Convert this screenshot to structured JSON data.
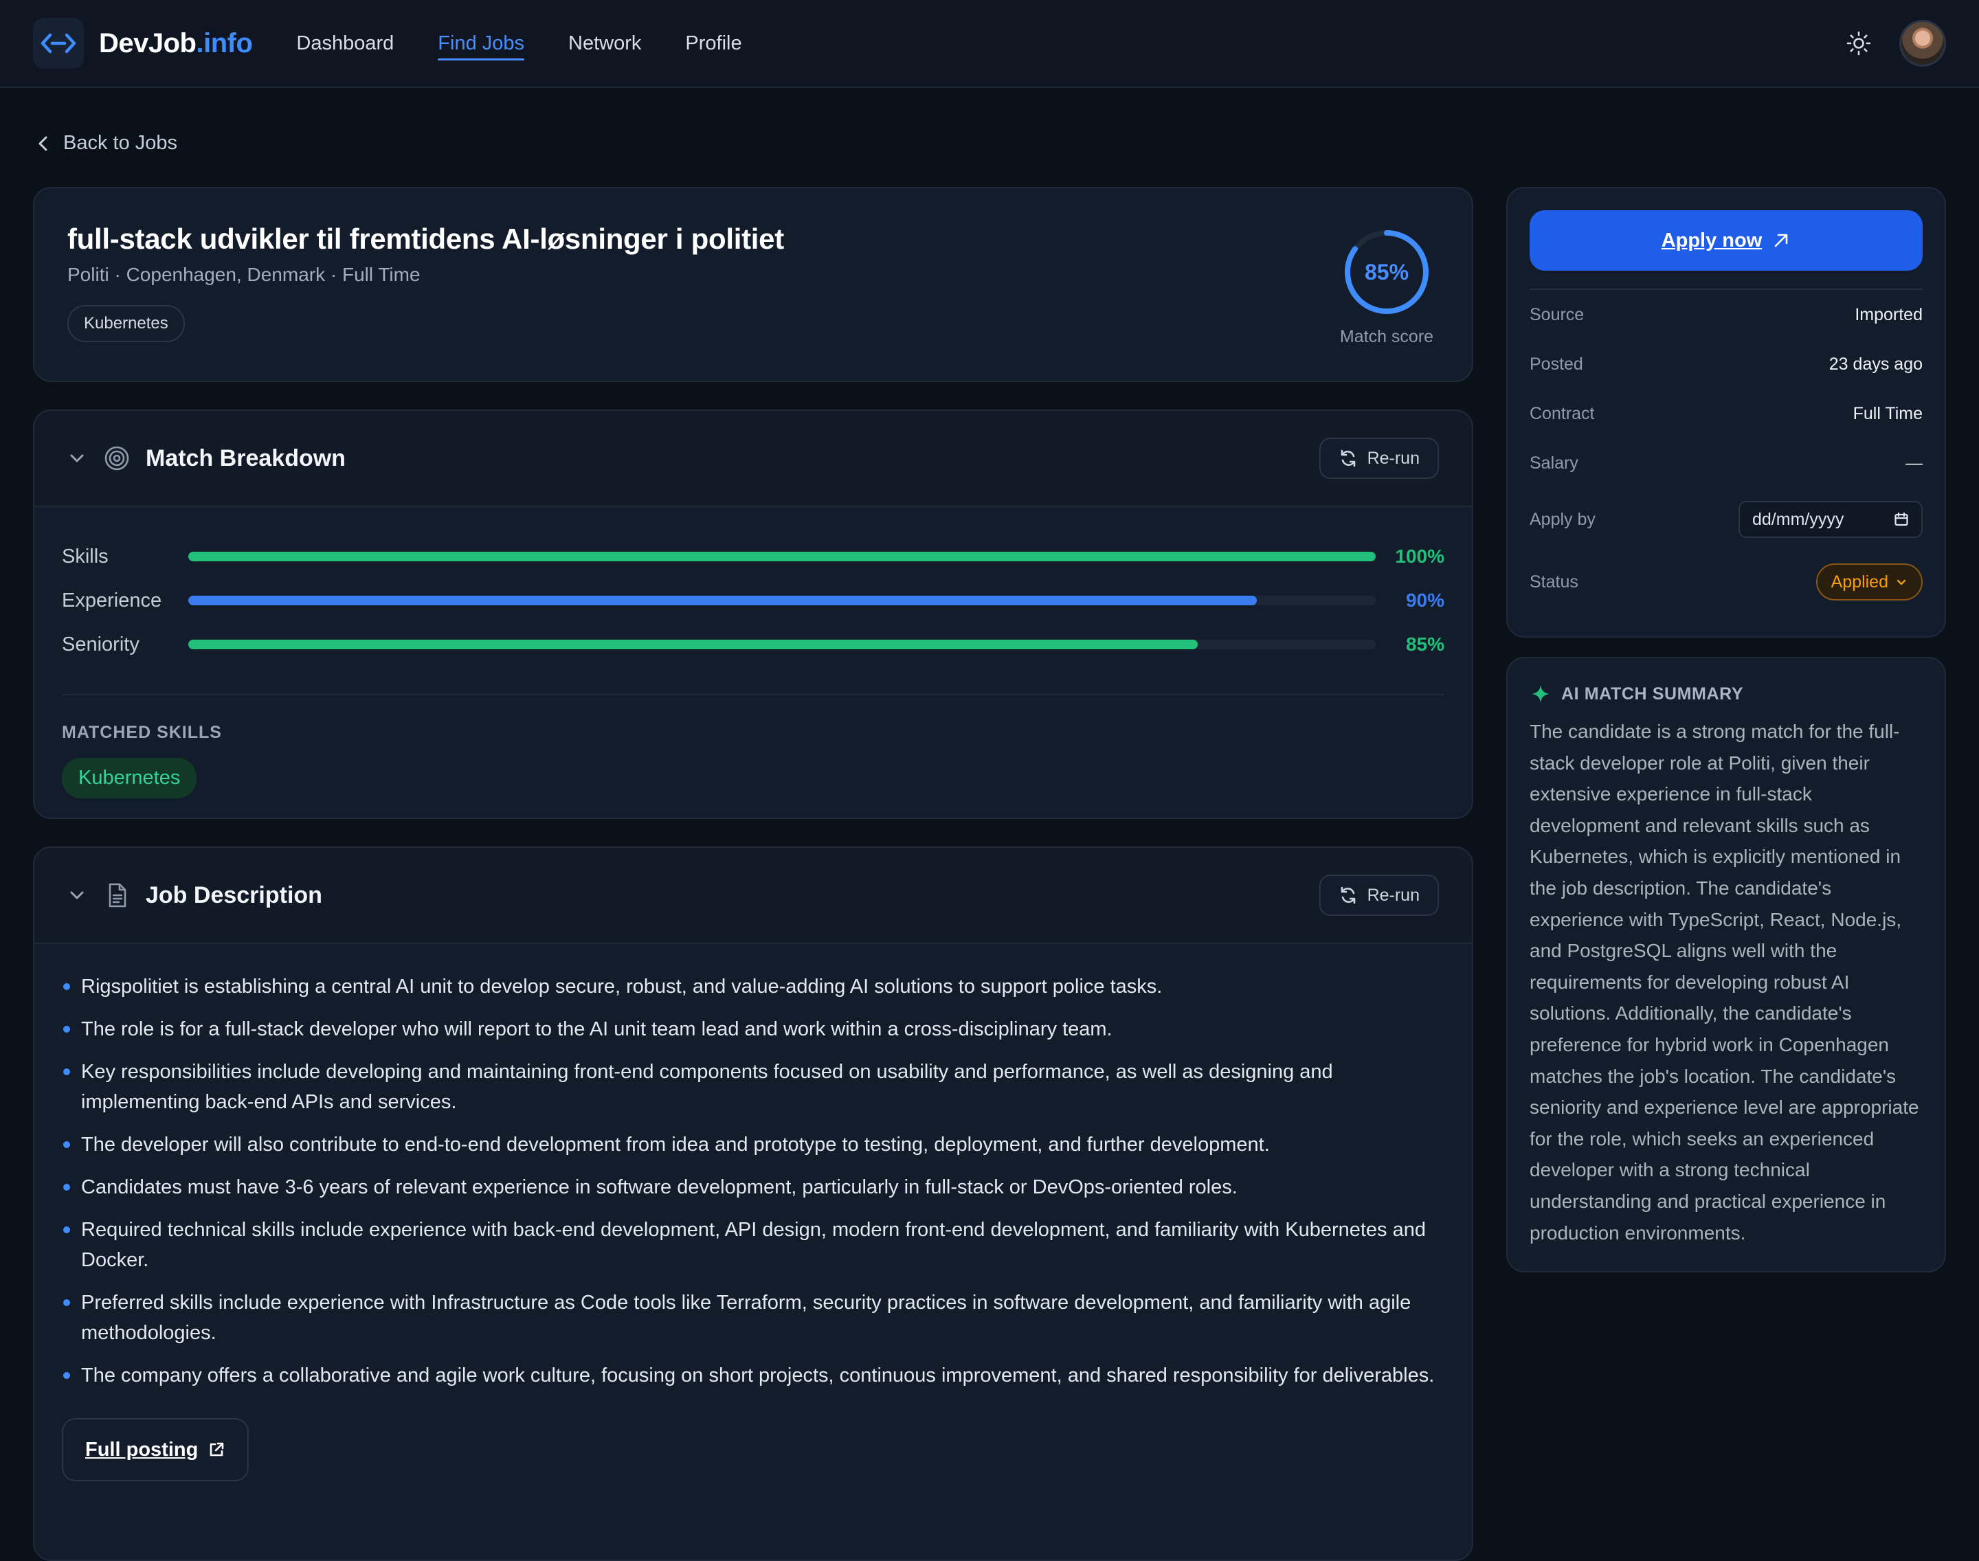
{
  "nav": {
    "brand_main": "DevJob",
    "brand_accent": ".info",
    "links": [
      "Dashboard",
      "Find Jobs",
      "Network",
      "Profile"
    ],
    "active_link": "Find Jobs"
  },
  "back_label": "Back to Jobs",
  "job": {
    "title": "full-stack udvikler til fremtidens AI-løsninger i politiet",
    "meta": "Politi · Copenhagen, Denmark · Full Time",
    "tag": "Kubernetes",
    "match_score_text": "85%",
    "match_score_value": 85,
    "match_score_label": "Match score"
  },
  "breakdown": {
    "title": "Match Breakdown",
    "rerun_label": "Re-run",
    "bars": [
      {
        "label": "Skills",
        "value": 100,
        "value_text": "100%",
        "color": "#22c07a"
      },
      {
        "label": "Experience",
        "value": 90,
        "value_text": "90%",
        "color": "#3b7cf0"
      },
      {
        "label": "Seniority",
        "value": 85,
        "value_text": "85%",
        "color": "#22c07a"
      }
    ],
    "matched_skills_label": "MATCHED SKILLS",
    "matched_skills": [
      "Kubernetes"
    ]
  },
  "description": {
    "title": "Job Description",
    "rerun_label": "Re-run",
    "items": [
      "Rigspolitiet is establishing a central AI unit to develop secure, robust, and value-adding AI solutions to support police tasks.",
      "The role is for a full-stack developer who will report to the AI unit team lead and work within a cross-disciplinary team.",
      "Key responsibilities include developing and maintaining front-end components focused on usability and performance, as well as designing and implementing back-end APIs and services.",
      "The developer will also contribute to end-to-end development from idea and prototype to testing, deployment, and further development.",
      "Candidates must have 3-6 years of relevant experience in software development, particularly in full-stack or DevOps-oriented roles.",
      "Required technical skills include experience with back-end development, API design, modern front-end development, and familiarity with Kubernetes and Docker.",
      "Preferred skills include experience with Infrastructure as Code tools like Terraform, security practices in software development, and familiarity with agile methodologies.",
      "The company offers a collaborative and agile work culture, focusing on short projects, continuous improvement, and shared responsibility for deliverables."
    ],
    "full_posting_label": "Full posting"
  },
  "sidebar": {
    "apply_label": "Apply now",
    "fields": [
      {
        "key": "Source",
        "value": "Imported"
      },
      {
        "key": "Posted",
        "value": "23 days ago"
      },
      {
        "key": "Contract",
        "value": "Full Time"
      },
      {
        "key": "Salary",
        "value": "—"
      }
    ],
    "apply_by_label": "Apply by",
    "apply_by_placeholder": "dd/mm/yyyy",
    "status_label": "Status",
    "status_value": "Applied"
  },
  "ai_summary": {
    "heading": "AI MATCH SUMMARY",
    "text": "The candidate is a strong match for the full-stack developer role at Politi, given their extensive experience in full-stack development and relevant skills such as Kubernetes, which is explicitly mentioned in the job description. The candidate's experience with TypeScript, React, Node.js, and PostgreSQL aligns well with the requirements for developing robust AI solutions. Additionally, the candidate's preference for hybrid work in Copenhagen matches the job's location. The candidate's seniority and experience level are appropriate for the role, which seeks an experienced developer with a strong technical understanding and practical experience in production environments."
  },
  "colors": {
    "accent": "#3f8cff",
    "success": "#22c07a",
    "warning": "#f59e0b",
    "background": "#0b1119",
    "card": "#131c2b"
  },
  "icons": [
    "code-arrows-icon",
    "sun-icon",
    "chevron-left-icon",
    "chevron-down-icon",
    "target-icon",
    "document-icon",
    "refresh-icon",
    "external-link-icon",
    "calendar-icon",
    "sparkle-icon"
  ]
}
